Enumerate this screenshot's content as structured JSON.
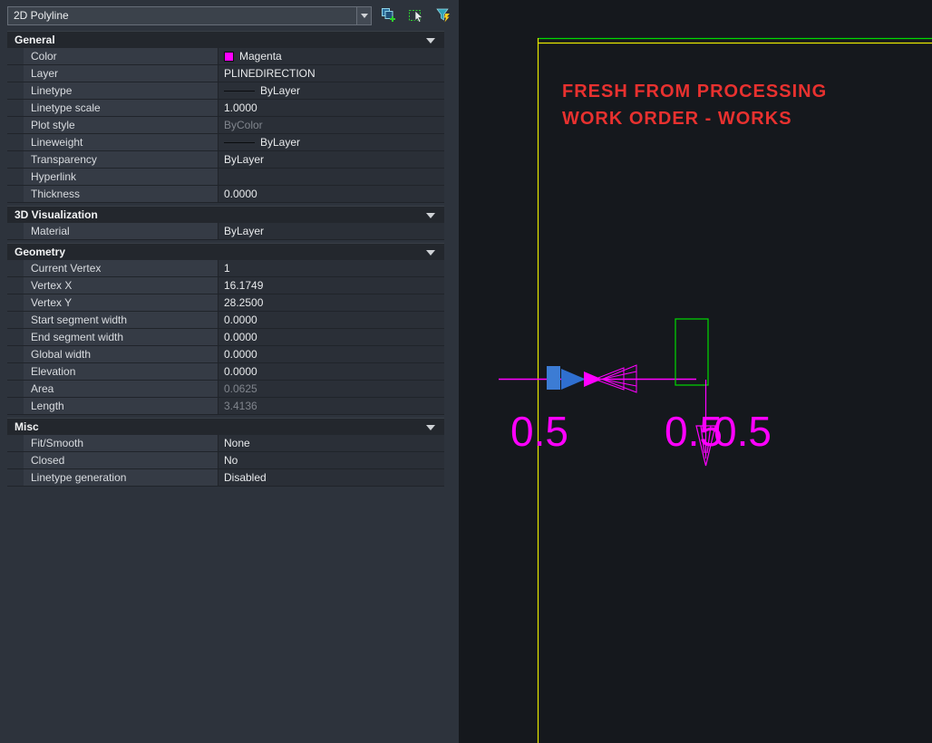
{
  "colors": {
    "entity_magenta": "#FF00FF",
    "entity_green": "#00D900",
    "entity_yellow": "#E8E800",
    "annotation_red": "#E8312F",
    "grip_blue": "#3C7CD4",
    "arrow_blue": "#2F6FD0",
    "panel_bg": "#2d333c",
    "canvas_bg": "#15181d"
  },
  "palette": {
    "selector": {
      "value": "2D Polyline"
    },
    "toolbar": [
      {
        "name": "toggle-pickadd"
      },
      {
        "name": "select-objects"
      },
      {
        "name": "quick-select"
      }
    ],
    "sections": [
      {
        "title": "General",
        "rows": [
          {
            "label": "Color",
            "value": "Magenta",
            "swatch": "#FF00FF"
          },
          {
            "label": "Layer",
            "value": "PLINEDIRECTION"
          },
          {
            "label": "Linetype",
            "value": "ByLayer"
          },
          {
            "label": "Linetype scale",
            "value": "1.0000"
          },
          {
            "label": "Plot style",
            "value": "ByColor"
          },
          {
            "label": "Lineweight",
            "value": "ByLayer"
          },
          {
            "label": "Transparency",
            "value": "ByLayer"
          },
          {
            "label": "Hyperlink",
            "value": ""
          },
          {
            "label": "Thickness",
            "value": "0.0000"
          }
        ]
      },
      {
        "title": "3D Visualization",
        "rows": [
          {
            "label": "Material",
            "value": "ByLayer"
          }
        ]
      },
      {
        "title": "Geometry",
        "rows": [
          {
            "label": "Current Vertex",
            "value": "1"
          },
          {
            "label": "Vertex X",
            "value": "16.1749"
          },
          {
            "label": "Vertex Y",
            "value": "28.2500"
          },
          {
            "label": "Start segment width",
            "value": "0.0000"
          },
          {
            "label": "End segment width",
            "value": "0.0000"
          },
          {
            "label": "Global width",
            "value": "0.0000"
          },
          {
            "label": "Elevation",
            "value": "0.0000"
          },
          {
            "label": "Area",
            "value": "0.0625"
          },
          {
            "label": "Length",
            "value": "3.4136"
          }
        ]
      },
      {
        "title": "Misc",
        "rows": [
          {
            "label": "Fit/Smooth",
            "value": "None"
          },
          {
            "label": "Closed",
            "value": "No"
          },
          {
            "label": "Linetype generation",
            "value": "Disabled"
          }
        ]
      }
    ]
  },
  "canvas": {
    "annotation_line1": "FRESH FROM PROCESSING",
    "annotation_line2": "WORK ORDER - WORKS",
    "dim_labels": [
      "0.5",
      "0.5",
      "0.5"
    ]
  }
}
